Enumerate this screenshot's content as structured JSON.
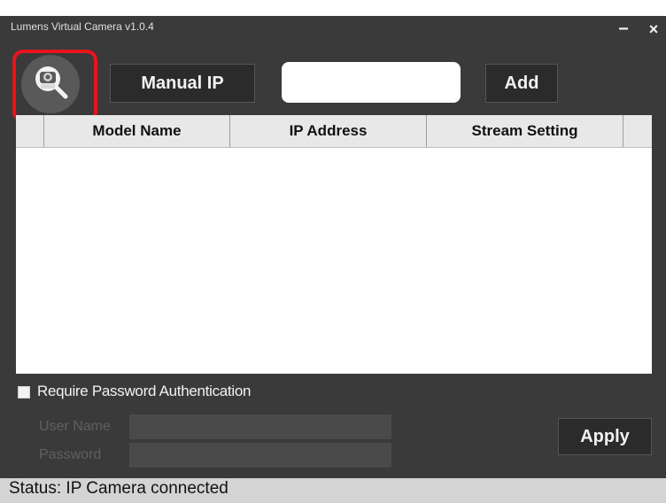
{
  "window": {
    "title": "Lumens Virtual Camera v1.0.4",
    "minimize_glyph": "−",
    "close_glyph": "×"
  },
  "toolbar": {
    "search_icon": "camera-search-icon",
    "manual_ip_label": "Manual IP",
    "ip_input_value": "",
    "add_label": "Add"
  },
  "table": {
    "columns": [
      "",
      "Model Name",
      "IP Address",
      "Stream Setting",
      ""
    ],
    "rows": []
  },
  "auth": {
    "checkbox_label": "Require Password Authentication",
    "checked": false,
    "user_name_label": "User Name",
    "password_label": "Password",
    "user_name_value": "",
    "password_value": "",
    "apply_label": "Apply"
  },
  "status": {
    "text": "Status: IP Camera connected"
  },
  "colors": {
    "window_bg": "#3a3a3a",
    "button_bg": "#2b2b2b",
    "highlight": "#e8141c",
    "status_bg": "#d4d4d4"
  }
}
